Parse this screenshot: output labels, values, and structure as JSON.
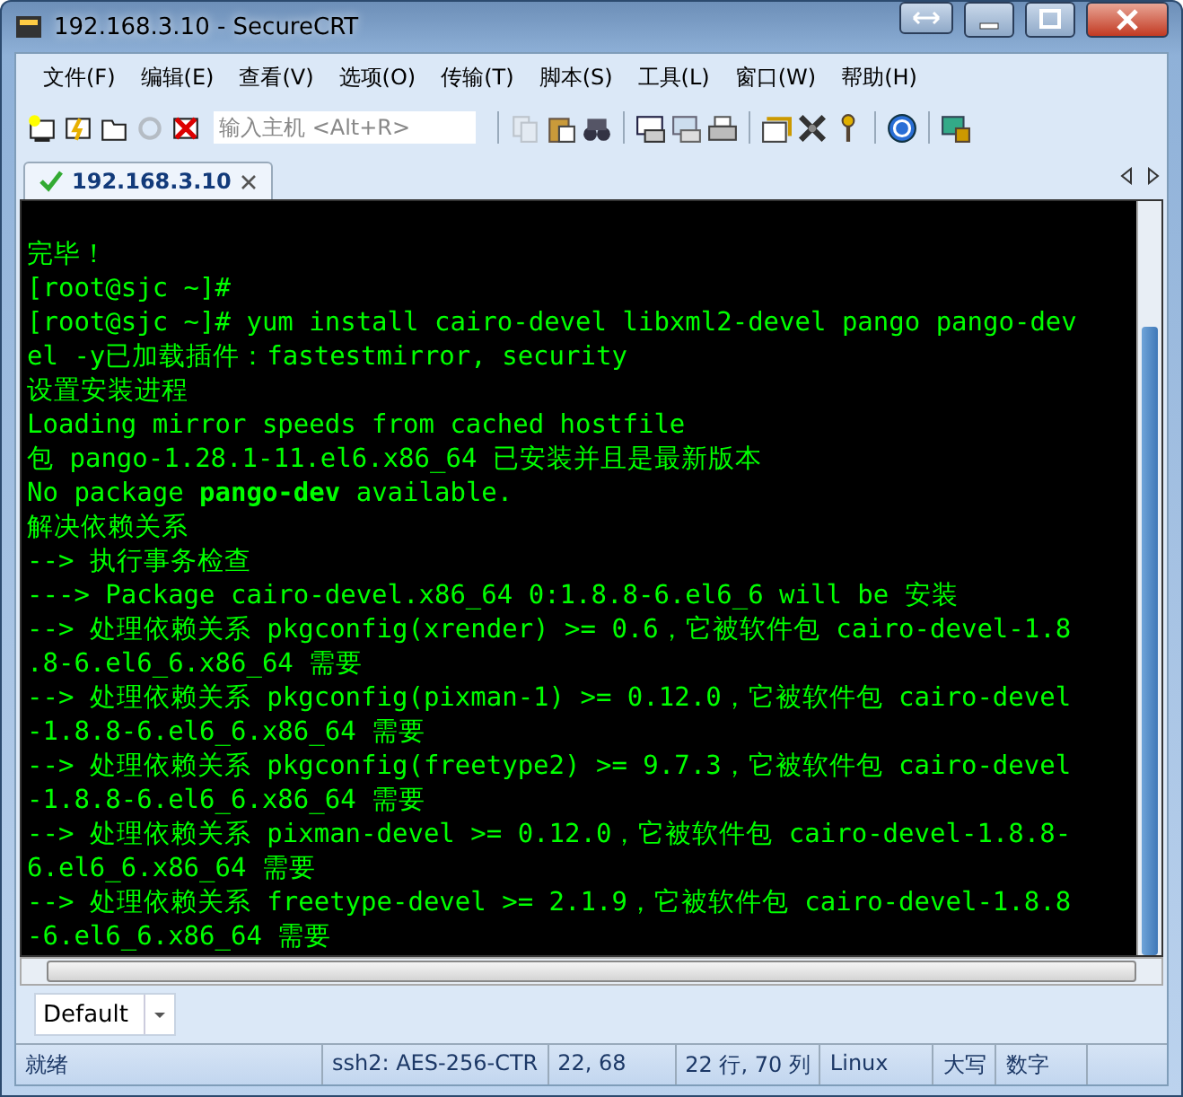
{
  "window": {
    "title": "192.168.3.10 - SecureCRT"
  },
  "menu": [
    "文件(F)",
    "编辑(E)",
    "查看(V)",
    "选项(O)",
    "传输(T)",
    "脚本(S)",
    "工具(L)",
    "窗口(W)",
    "帮助(H)"
  ],
  "toolbar": {
    "left": [
      {
        "kind": "connect",
        "disabled": false
      },
      {
        "kind": "quick",
        "disabled": false
      },
      {
        "kind": "tab",
        "disabled": false
      },
      {
        "kind": "reconnect",
        "disabled": true
      },
      {
        "kind": "disconnect",
        "disabled": false
      }
    ],
    "host_field": {
      "placeholder": "输入主机 <Alt+R>"
    },
    "right": [
      {
        "kind": "copy",
        "disabled": true
      },
      {
        "kind": "paste",
        "disabled": false
      },
      {
        "kind": "find",
        "disabled": false
      },
      {
        "kind": "sep"
      },
      {
        "kind": "printscreen",
        "disabled": false
      },
      {
        "kind": "printsel",
        "disabled": false
      },
      {
        "kind": "print",
        "disabled": false
      },
      {
        "kind": "sep"
      },
      {
        "kind": "options",
        "disabled": false
      },
      {
        "kind": "tools",
        "disabled": false
      },
      {
        "kind": "key",
        "disabled": false
      },
      {
        "kind": "sep"
      },
      {
        "kind": "help",
        "disabled": false
      },
      {
        "kind": "sep"
      },
      {
        "kind": "lock",
        "disabled": false
      }
    ]
  },
  "tabs": [
    {
      "label": "192.168.3.10",
      "selected": true,
      "connected": true
    }
  ],
  "terminal": {
    "lines": [
      "完毕！",
      "[root@sjc ~]#",
      "[root@sjc ~]# yum install cairo-devel libxml2-devel pango pango-dev",
      "el -y已加载插件：fastestmirror, security",
      "设置安装进程",
      "Loading mirror speeds from cached hostfile",
      "包 pango-1.28.1-11.el6.x86_64 已安装并且是最新版本",
      "No package **pango-dev** available.",
      "解决依赖关系",
      "--> 执行事务检查",
      "---> Package cairo-devel.x86_64 0:1.8.8-6.el6_6 will be 安装",
      "--> 处理依赖关系 pkgconfig(xrender) >= 0.6，它被软件包 cairo-devel-1.8",
      ".8-6.el6_6.x86_64 需要",
      "--> 处理依赖关系 pkgconfig(pixman-1) >= 0.12.0，它被软件包 cairo-devel",
      "-1.8.8-6.el6_6.x86_64 需要",
      "--> 处理依赖关系 pkgconfig(freetype2) >= 9.7.3，它被软件包 cairo-devel",
      "-1.8.8-6.el6_6.x86_64 需要",
      "--> 处理依赖关系 pixman-devel >= 0.12.0，它被软件包 cairo-devel-1.8.8-",
      "6.el6_6.x86_64 需要",
      "--> 处理依赖关系 freetype-devel >= 2.1.9，它被软件包 cairo-devel-1.8.8",
      "-6.el6_6.x86_64 需要"
    ]
  },
  "session_combo": {
    "value": "Default"
  },
  "status_bar": [
    "就绪",
    "ssh2: AES-256-CTR",
    "22,  68",
    "22 行, 70 列",
    "Linux",
    "大写",
    "数字"
  ]
}
